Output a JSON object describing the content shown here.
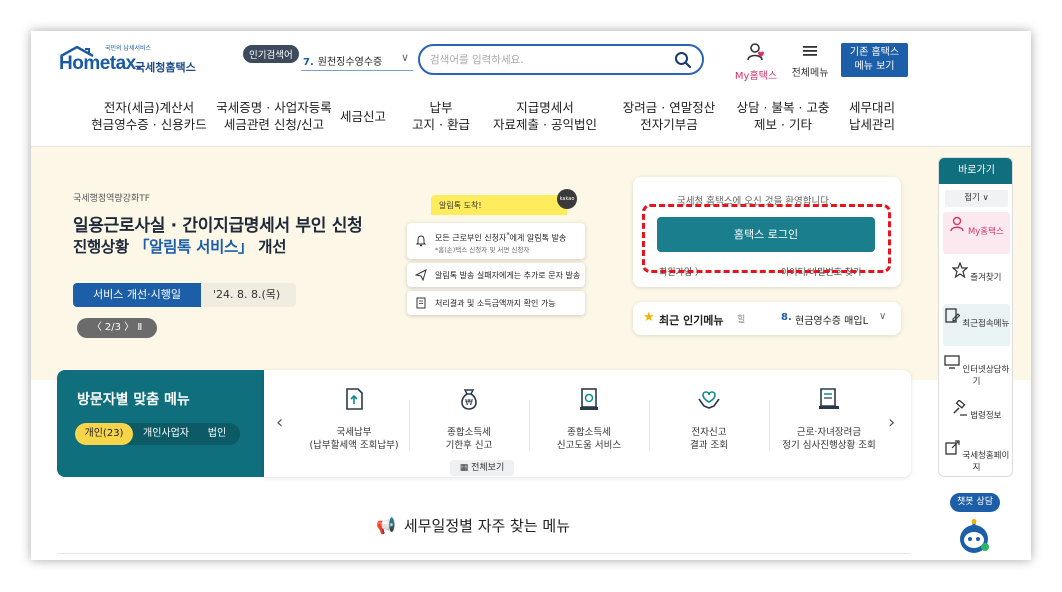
{
  "header": {
    "logo_small": "국민의 납세서비스",
    "logo_en": "Hometax.",
    "logo_ko": "국세청홈택스",
    "popular_label": "인기검색어",
    "popular_num": "7.",
    "popular_item": "원천징수영수증",
    "search_placeholder": "검색어를 입력하세요.",
    "my_hometax": "My홈택스",
    "all_menu": "전체메뉴",
    "old_view_line1": "기존 홈택스",
    "old_view_line2": "메뉴 보기"
  },
  "gnb": [
    {
      "l1": "전자(세금)계산서",
      "l2": "현금영수증 · 신용카드"
    },
    {
      "l1": "국세증명 · 사업자등록",
      "l2": "세금관련 신청/신고"
    },
    {
      "l1": "세금신고",
      "l2": ""
    },
    {
      "l1": "납부",
      "l2": "고지 · 환급"
    },
    {
      "l1": "지급명세서",
      "l2": "자료제출 · 공익법인"
    },
    {
      "l1": "장려금 · 연말정산",
      "l2": "전자기부금"
    },
    {
      "l1": "상담 · 불복 · 고충",
      "l2": "제보 · 기타"
    },
    {
      "l1": "세무대리",
      "l2": "납세관리"
    }
  ],
  "hero": {
    "tag": "국세행정역량강화TF",
    "title1": "일용근로사실 · 간이지급명세서 부인 신청",
    "title2_pre": "진행상황 ",
    "title2_hl": "「알림톡 서비스」",
    "title2_post": " 개선",
    "pill_label": "서비스 개선·시행일",
    "pill_date": "'24. 8. 8.(목)",
    "pager": "〈 2/3 〉 Ⅱ",
    "card_head": "알림톡 도착!",
    "kakao": "kakao",
    "card1_main_pre": "모든 근로부인 신청자",
    "card1_sup": "*",
    "card1_main_post": "에게 알림톡 발송",
    "card1_sub": "*홈(손)택스 신청자 및 서면 신청자",
    "card2": "알림톡 발송 실패자에게는 추가로 문자 발송",
    "card3": "처리결과 및 소득금액까지 확인 가능"
  },
  "login": {
    "welcome": "국세청 홈택스에 오신 것을 환영합니다.",
    "button": "홈택스 로그인",
    "join": "회원가입 〉",
    "find": "아이디/비밀번호 찾기"
  },
  "recent": {
    "label": "최근 인기메뉴",
    "sep": "힐",
    "num": "8.",
    "item": "현금영수증 매입L"
  },
  "visitor": {
    "title": "방문자별 맞춤 메뉴",
    "tabs": [
      "개인(23)",
      "개인사업자",
      "법인"
    ]
  },
  "services": [
    {
      "icon": "document-upload-icon",
      "l1": "국세납부",
      "l2": "(납부할세액 조회납부)"
    },
    {
      "icon": "money-bag-icon",
      "l1": "종합소득세",
      "l2": "기한후 신고"
    },
    {
      "icon": "tax-form-icon",
      "l1": "종합소득세",
      "l2": "신고도움 서비스"
    },
    {
      "icon": "heart-hands-icon",
      "l1": "전자신고",
      "l2": "결과 조회"
    },
    {
      "icon": "receipt-icon",
      "l1": "근로·자녀장려금",
      "l2": "정기 심사진행상황 조회"
    }
  ],
  "services_viewall": "전체보기",
  "schedule_title": "세무일정별 자주 찾는 메뉴",
  "quick": {
    "head": "바로가기",
    "fold": "접기 ∨",
    "items": [
      "My홈택스",
      "즐겨찾기",
      "최근접속메뉴",
      "인터넷상담하기",
      "법령정보",
      "국세청홈페이지"
    ]
  },
  "chatbot": "챗봇 상담",
  "colors": {
    "brand_blue": "#1c5fa8",
    "teal": "#0f6f7d",
    "hero_bg": "#fcf7e7",
    "highlight_red": "#e8141c"
  }
}
